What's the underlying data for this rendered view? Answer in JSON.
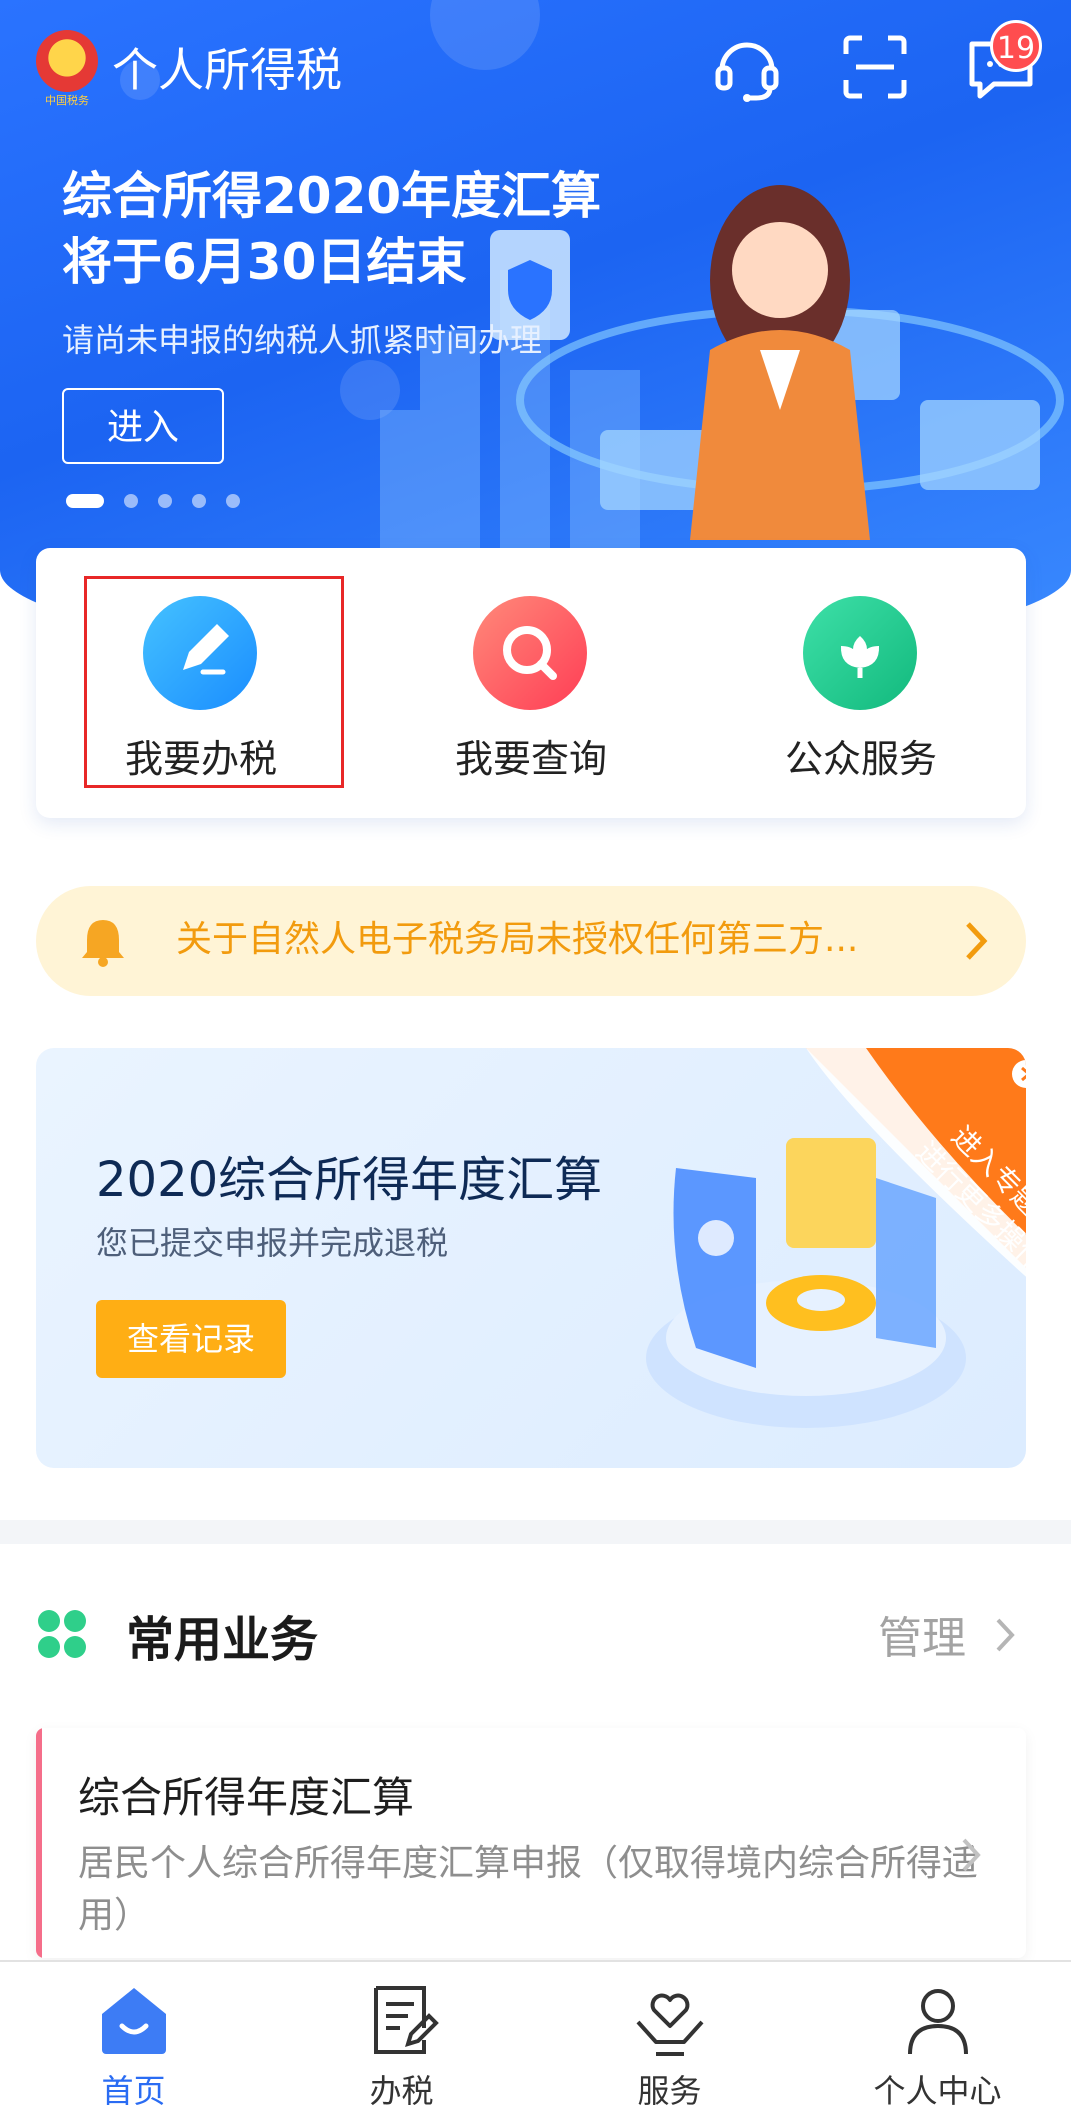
{
  "header": {
    "app_title": "个人所得税",
    "emblem_caption": "中国税务",
    "message_badge": "19",
    "icons": [
      "headset-icon",
      "scan-icon",
      "message-icon"
    ]
  },
  "banner": {
    "headline_line1": "综合所得2020年度汇算",
    "headline_line2": "将于6月30日结束",
    "subtitle": "请尚未申报的纳税人抓紧时间办理",
    "enter_label": "进入",
    "carousel_active_index": 0,
    "carousel_count": 5
  },
  "quick_actions": [
    {
      "label": "我要办税",
      "icon": "edit-icon",
      "color": "#1ea1ff"
    },
    {
      "label": "我要查询",
      "icon": "search-icon",
      "color": "#ff5a5f"
    },
    {
      "label": "公众服务",
      "icon": "flower-icon",
      "color": "#1ccc8c"
    }
  ],
  "notice": {
    "text": "关于自然人电子税务局未授权任何第三方...",
    "icon": "bell-icon"
  },
  "annual_card": {
    "title": "2020综合所得年度汇算",
    "subtitle": "您已提交申报并完成退税",
    "button_label": "查看记录",
    "ribbon_line1": "进入专题页",
    "ribbon_line2": "进行更多操作"
  },
  "common_services": {
    "title": "常用业务",
    "manage_label": "管理",
    "items": [
      {
        "title": "综合所得年度汇算",
        "description": "居民个人综合所得年度汇算申报（仅取得境内综合所得适用）"
      }
    ]
  },
  "tabbar": {
    "items": [
      {
        "label": "首页",
        "icon": "home-icon",
        "active": true
      },
      {
        "label": "办税",
        "icon": "document-edit-icon",
        "active": false
      },
      {
        "label": "服务",
        "icon": "heart-hand-icon",
        "active": false
      },
      {
        "label": "个人中心",
        "icon": "person-icon",
        "active": false
      }
    ]
  },
  "colors": {
    "brand_blue": "#2a6cf3",
    "highlight_box": "#e82727",
    "notice_bg": "#fff4d6",
    "notice_text": "#f29b0e",
    "record_button": "#ffae14"
  }
}
